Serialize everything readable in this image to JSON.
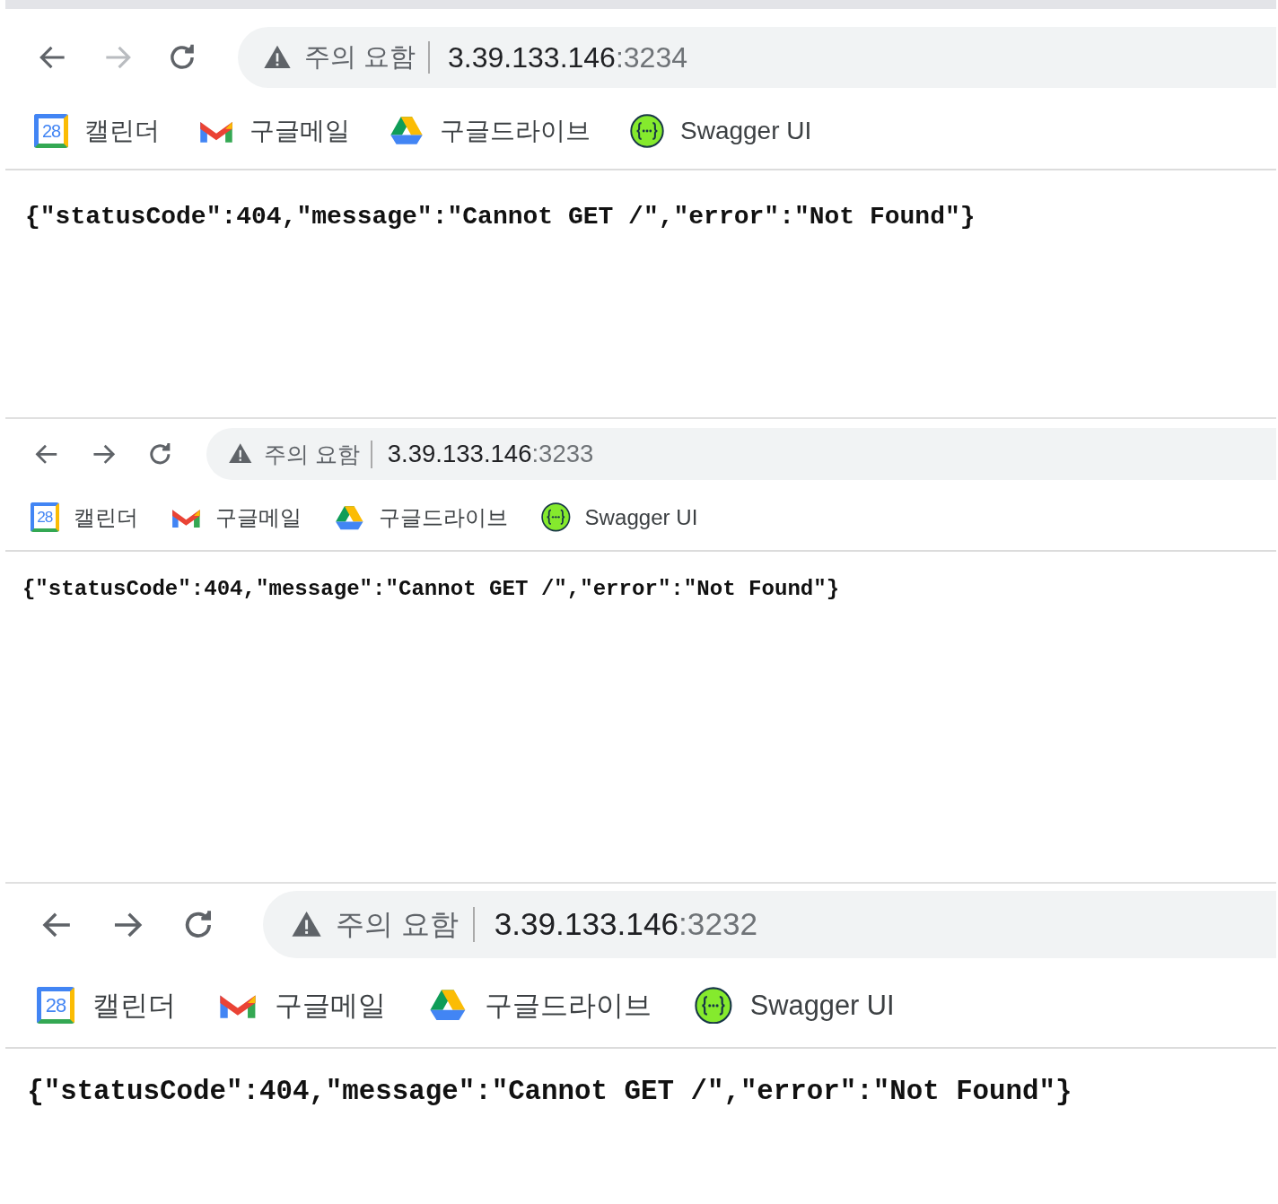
{
  "windows": [
    {
      "back_disabled": false,
      "forward_disabled": true,
      "security_label": "주의 요함",
      "host": "3.39.133.146",
      "port": ":3234",
      "bookmarks": [
        {
          "kind": "calendar",
          "label": "캘린더",
          "icon_text": "28"
        },
        {
          "kind": "gmail",
          "label": "구글메일"
        },
        {
          "kind": "drive",
          "label": "구글드라이브"
        },
        {
          "kind": "swagger",
          "label": "Swagger UI"
        }
      ],
      "body": "{\"statusCode\":404,\"message\":\"Cannot GET /\",\"error\":\"Not Found\"}"
    },
    {
      "back_disabled": false,
      "forward_disabled": false,
      "security_label": "주의 요함",
      "host": "3.39.133.146",
      "port": ":3233",
      "bookmarks": [
        {
          "kind": "calendar",
          "label": "캘린더",
          "icon_text": "28"
        },
        {
          "kind": "gmail",
          "label": "구글메일"
        },
        {
          "kind": "drive",
          "label": "구글드라이브"
        },
        {
          "kind": "swagger",
          "label": "Swagger UI"
        }
      ],
      "body": "{\"statusCode\":404,\"message\":\"Cannot GET /\",\"error\":\"Not Found\"}"
    },
    {
      "back_disabled": false,
      "forward_disabled": false,
      "security_label": "주의 요함",
      "host": "3.39.133.146",
      "port": ":3232",
      "bookmarks": [
        {
          "kind": "calendar",
          "label": "캘린더",
          "icon_text": "28"
        },
        {
          "kind": "gmail",
          "label": "구글메일"
        },
        {
          "kind": "drive",
          "label": "구글드라이브"
        },
        {
          "kind": "swagger",
          "label": "Swagger UI"
        }
      ],
      "body": "{\"statusCode\":404,\"message\":\"Cannot GET /\",\"error\":\"Not Found\"}"
    }
  ]
}
